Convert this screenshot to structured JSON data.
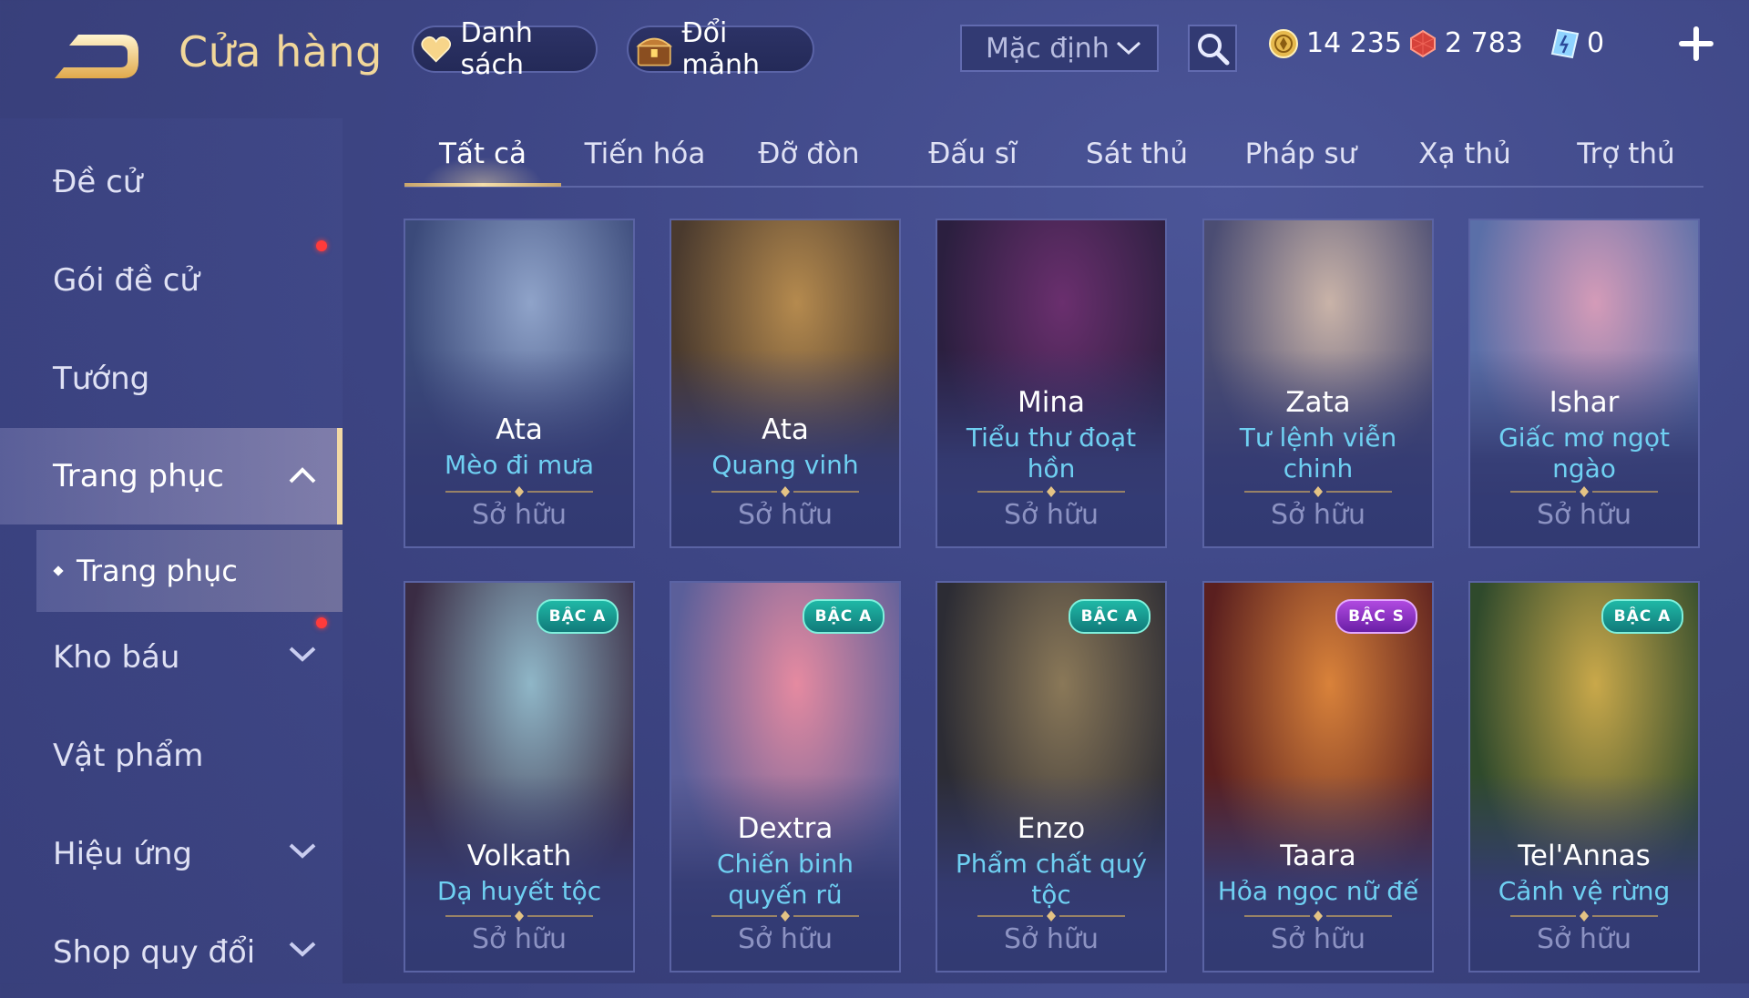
{
  "header": {
    "title": "Cửa hàng",
    "list_button": "Danh sách",
    "shard_button": "Đổi mảnh",
    "sort": {
      "selected": "Mặc định"
    },
    "currency": {
      "gold": "14 235",
      "ruby": "2 783",
      "voucher": "0"
    }
  },
  "sidebar": {
    "items": [
      {
        "label": "Đề cử"
      },
      {
        "label": "Gói đề cử"
      },
      {
        "label": "Tướng"
      },
      {
        "label": "Trang phục"
      },
      {
        "label": "Trang phục"
      },
      {
        "label": "Kho báu"
      },
      {
        "label": "Vật phẩm"
      },
      {
        "label": "Hiệu ứng"
      },
      {
        "label": "Shop quy đổi"
      }
    ]
  },
  "tabs": [
    "Tất cả",
    "Tiến hóa",
    "Đỡ đòn",
    "Đấu sĩ",
    "Sát thủ",
    "Pháp sư",
    "Xạ thủ",
    "Trợ thủ"
  ],
  "cards": [
    {
      "hero": "Ata",
      "skin": "Mèo đi mưa",
      "status": "Sở hữu",
      "badge": "",
      "colors": [
        "#8fa3c9",
        "#3b4a7a"
      ]
    },
    {
      "hero": "Ata",
      "skin": "Quang vinh",
      "status": "Sở hữu",
      "badge": "",
      "colors": [
        "#b58a4e",
        "#4a3a2e"
      ]
    },
    {
      "hero": "Mina",
      "skin": "Tiểu thư đoạt hồn",
      "status": "Sở hữu",
      "badge": "",
      "colors": [
        "#6a2f6e",
        "#2b1f3f"
      ]
    },
    {
      "hero": "Zata",
      "skin": "Tư lệnh viễn chinh",
      "status": "Sở hữu",
      "badge": "",
      "colors": [
        "#c9b3a8",
        "#4b4d73"
      ]
    },
    {
      "hero": "Ishar",
      "skin": "Giấc mơ ngọt ngào",
      "status": "Sở hữu",
      "badge": "",
      "colors": [
        "#d49bb8",
        "#5a6fa8"
      ]
    },
    {
      "hero": "Volkath",
      "skin": "Dạ huyết tộc",
      "status": "Sở hữu",
      "badge": "BẬC A",
      "colors": [
        "#8fb6c7",
        "#3a2c44"
      ]
    },
    {
      "hero": "Dextra",
      "skin": "Chiến binh quyến rũ",
      "status": "Sở hữu",
      "badge": "BẬC A",
      "colors": [
        "#e58aa0",
        "#5b5f9a"
      ]
    },
    {
      "hero": "Enzo",
      "skin": "Phẩm chất quý tộc",
      "status": "Sở hữu",
      "badge": "BẬC A",
      "colors": [
        "#8a7858",
        "#2c2c34"
      ]
    },
    {
      "hero": "Taara",
      "skin": "Hỏa ngọc nữ đế",
      "status": "Sở hữu",
      "badge": "BẬC S",
      "colors": [
        "#d9823a",
        "#5a1f1f"
      ]
    },
    {
      "hero": "Tel'Annas",
      "skin": "Cảnh vệ rừng",
      "status": "Sở hữu",
      "badge": "BẬC A",
      "colors": [
        "#c9a84a",
        "#2f4a2c"
      ]
    }
  ],
  "icons": {
    "back": "back-arrow-icon",
    "heart": "heart-icon",
    "chest": "chest-icon",
    "search": "search-icon",
    "gold": "gold-coin-icon",
    "ruby": "ruby-icon",
    "voucher": "voucher-icon",
    "plus": "plus-icon",
    "chevron": "chevron-icon"
  }
}
